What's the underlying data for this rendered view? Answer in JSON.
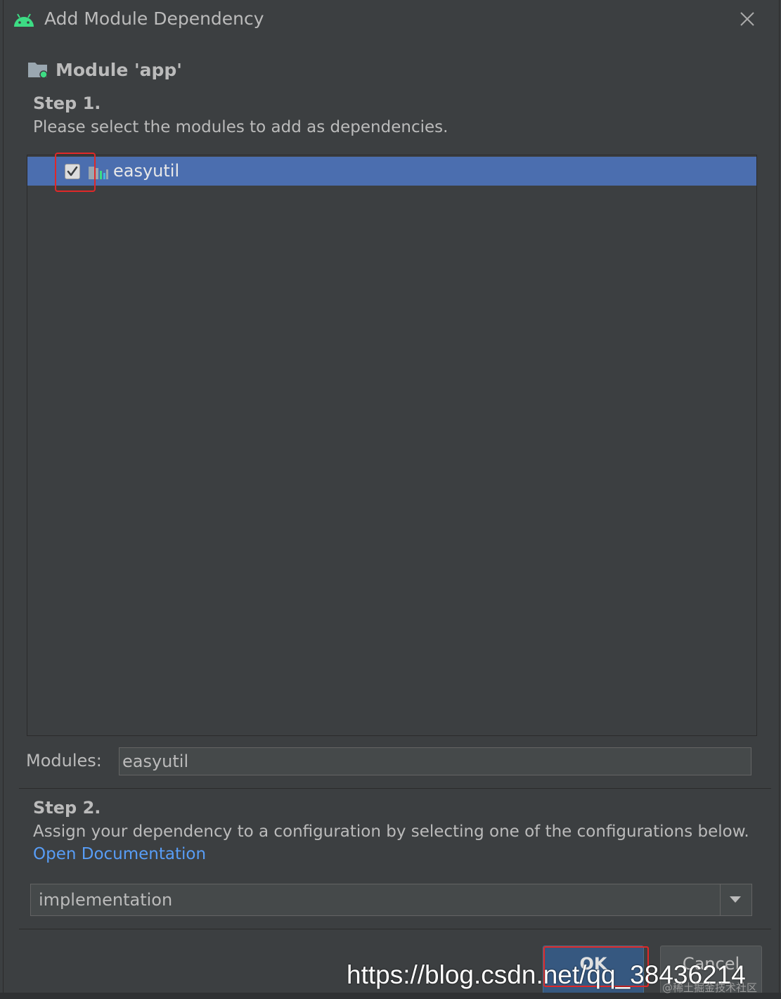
{
  "window": {
    "title": "Add Module Dependency",
    "close_icon": "close-icon"
  },
  "module_header": {
    "title": "Module 'app'",
    "icon": "module-folder-icon"
  },
  "step1": {
    "title": "Step 1.",
    "description": "Please select the modules to add as dependencies."
  },
  "modules_list": {
    "items": [
      {
        "label": "easyutil",
        "checked": true,
        "selected": true,
        "icon": "library-module-icon"
      }
    ]
  },
  "modules_field": {
    "label": "Modules:",
    "value": "easyutil"
  },
  "step2": {
    "title": "Step 2.",
    "description": "Assign your dependency to a configuration by selecting one of the configurations below.",
    "link": "Open Documentation"
  },
  "configuration": {
    "selected": "implementation"
  },
  "buttons": {
    "ok": "OK",
    "cancel": "Cancel"
  },
  "watermark": {
    "url": "https://blog.csdn.net/qq_38436214",
    "sub": "@稀土掘金技术社区"
  },
  "colors": {
    "selection": "#4b6eaf",
    "link": "#589df6",
    "highlight": "#e02828",
    "ok_button": "#365880"
  }
}
